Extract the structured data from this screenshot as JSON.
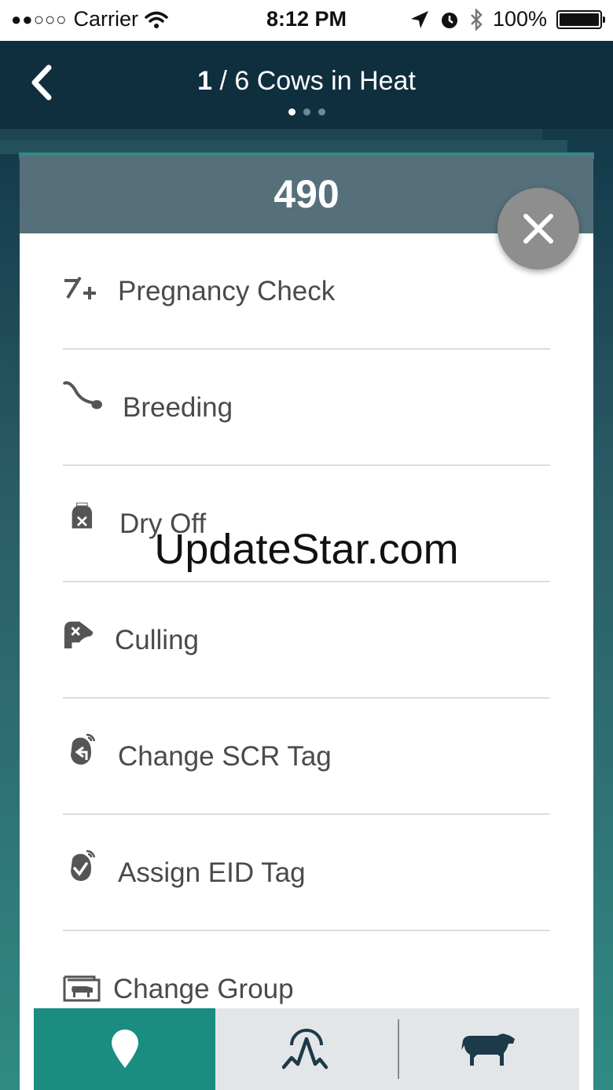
{
  "status_bar": {
    "signal": "●●○○○",
    "carrier": "Carrier",
    "time": "8:12 PM",
    "battery": "100%"
  },
  "nav": {
    "index": "1",
    "title_rest": "/ 6 Cows in Heat",
    "page_count": 3,
    "active_page": 0
  },
  "card": {
    "cow_id": "490",
    "menu": [
      {
        "label": "Pregnancy Check",
        "icon": "pregnancy-check-icon"
      },
      {
        "label": "Breeding",
        "icon": "breeding-icon"
      },
      {
        "label": "Dry Off",
        "icon": "dry-off-icon"
      },
      {
        "label": "Culling",
        "icon": "culling-icon"
      },
      {
        "label": "Change SCR Tag",
        "icon": "change-tag-icon"
      },
      {
        "label": "Assign EID Tag",
        "icon": "assign-tag-icon"
      },
      {
        "label": "Change Group",
        "icon": "change-group-icon"
      }
    ]
  },
  "watermark": "UpdateStar.com",
  "tabs": [
    {
      "icon": "location-pin-icon",
      "active": true
    },
    {
      "icon": "activity-graph-icon",
      "active": false
    },
    {
      "icon": "cow-icon",
      "active": false
    }
  ],
  "colors": {
    "accent": "#1a8c80",
    "header": "#0f2f3f",
    "card_header": "#56707b"
  }
}
